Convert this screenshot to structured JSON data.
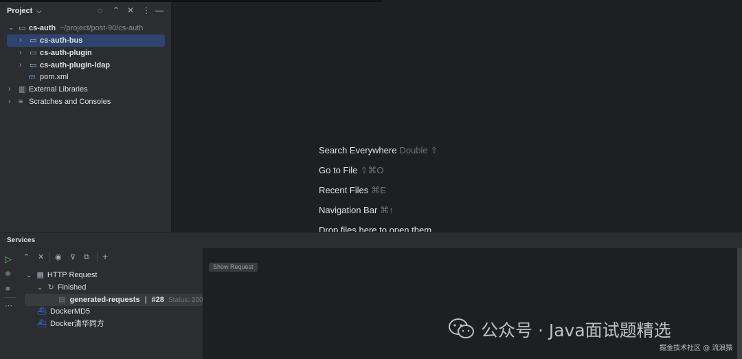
{
  "project_panel": {
    "title": "Project",
    "header_icons": [
      "locate-icon",
      "expand-all-icon",
      "collapse-all-icon",
      "more-icon",
      "minimize-icon"
    ],
    "tree": [
      {
        "name": "cs-auth",
        "path": "~/project/post-90/cs-auth",
        "icon": "folder-module-icon",
        "expanded": true
      },
      {
        "name": "cs-auth-bus",
        "icon": "folder-module-icon",
        "selected": true
      },
      {
        "name": "cs-auth-plugin",
        "icon": "folder-module-icon"
      },
      {
        "name": "cs-auth-plugin-ldap",
        "icon": "folder-module-icon"
      },
      {
        "name": "pom.xml",
        "icon": "maven-icon"
      },
      {
        "name": "External Libraries",
        "icon": "library-icon"
      },
      {
        "name": "Scratches and Consoles",
        "icon": "scratches-icon"
      }
    ]
  },
  "editor": {
    "hints": [
      {
        "label": "Search Everywhere",
        "shortcut": "Double ⇧"
      },
      {
        "label": "Go to File",
        "shortcut": "⇧⌘O"
      },
      {
        "label": "Recent Files",
        "shortcut": "⌘E"
      },
      {
        "label": "Navigation Bar",
        "shortcut": "⌘↑"
      },
      {
        "label": "Drop files here to open them",
        "shortcut": ""
      }
    ]
  },
  "services": {
    "title": "Services",
    "show_request_label": "Show Request",
    "tree": {
      "http_request": "HTTP Request",
      "finished": "Finished",
      "generated": "generated-requests",
      "separator": "|",
      "run_number": "#28",
      "status": "Status: 200",
      "docker1": "DockerMD5",
      "docker2": "Docker清华同方"
    }
  },
  "watermark": {
    "text": "公众号 · Java面试题精选",
    "sub": "掘金技术社区 @ 流浪猿"
  },
  "colors": {
    "selection": "#2e436e",
    "panel_bg": "#2b2d30",
    "editor_bg": "#1e1f22",
    "run_green": "#5fb865",
    "docker_blue": "#3574f0"
  }
}
